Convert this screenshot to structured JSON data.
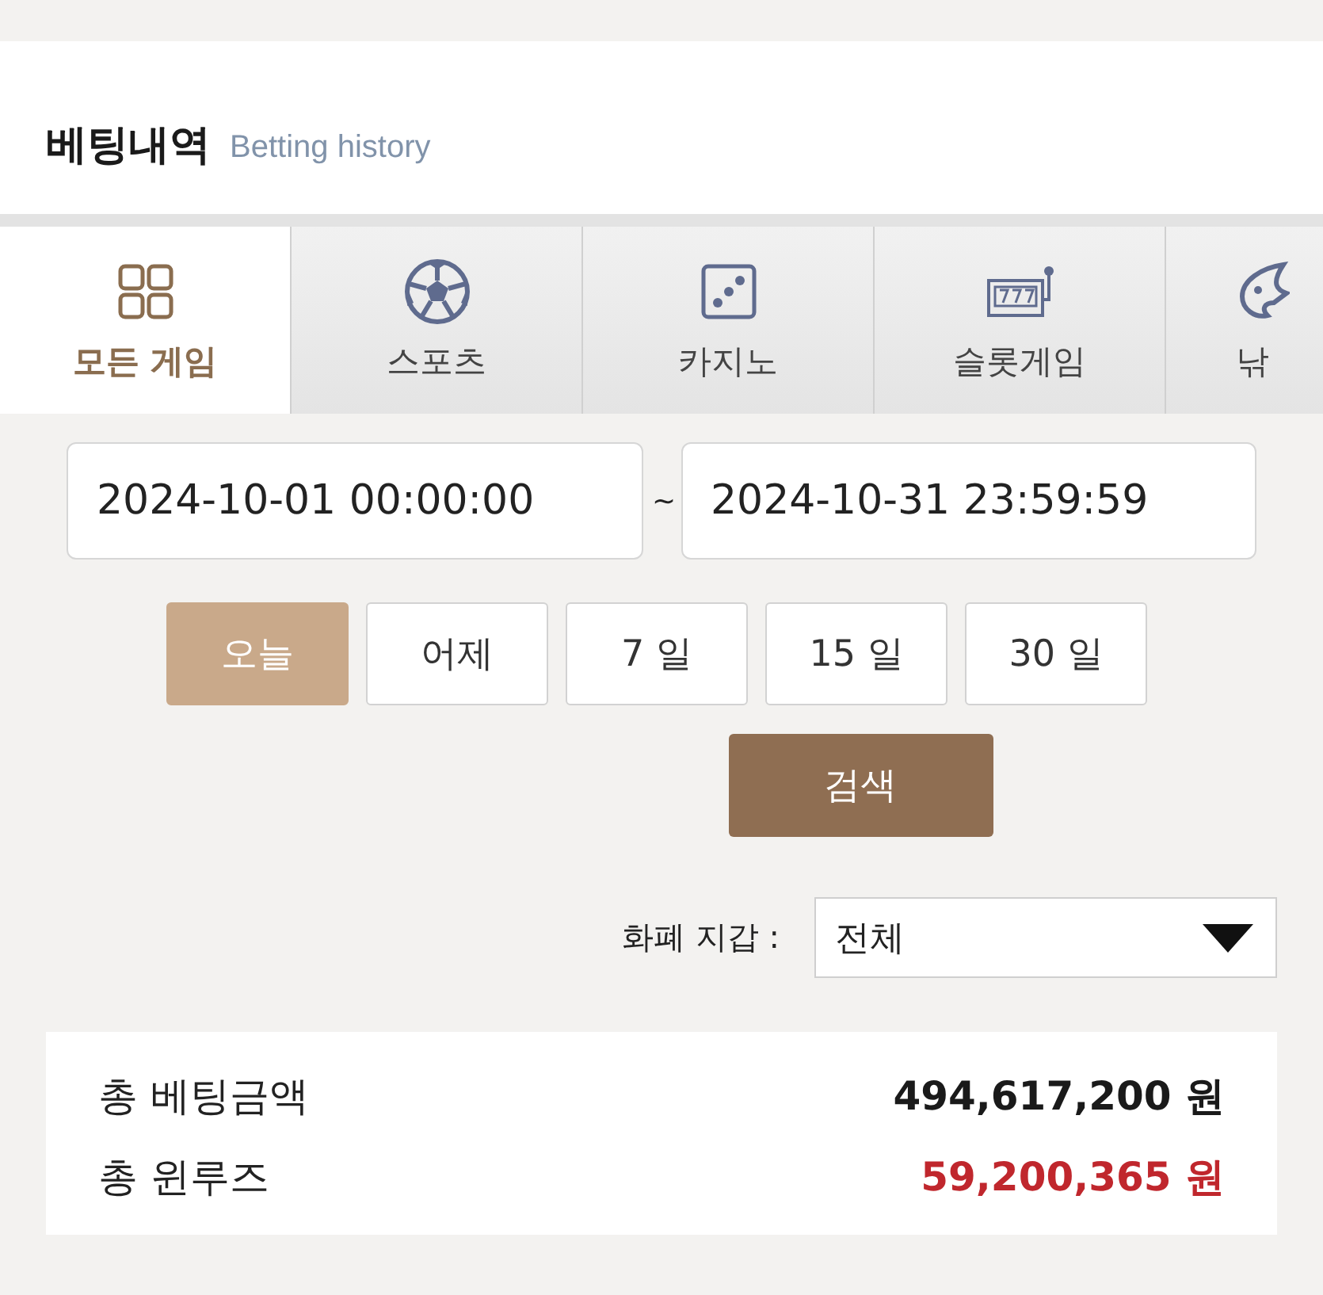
{
  "header": {
    "title": "베팅내역",
    "subtitle": "Betting history"
  },
  "tabs": [
    {
      "label": "모든 게임",
      "kind": "grid",
      "selected": true
    },
    {
      "label": "스포츠",
      "kind": "ball",
      "selected": false
    },
    {
      "label": "카지노",
      "kind": "dice",
      "selected": false
    },
    {
      "label": "슬롯게임",
      "kind": "slot",
      "selected": false
    },
    {
      "label": "낚",
      "kind": "fish",
      "selected": false
    }
  ],
  "date_range": {
    "start": "2024-10-01 00:00:00",
    "separator": "~",
    "end": "2024-10-31 23:59:59"
  },
  "quick_ranges": [
    {
      "label": "오늘",
      "selected": true
    },
    {
      "label": "어제",
      "selected": false
    },
    {
      "label": "7 일",
      "selected": false
    },
    {
      "label": "15 일",
      "selected": false
    },
    {
      "label": "30 일",
      "selected": false
    }
  ],
  "search_button": "검색",
  "currency_filter": {
    "label": "화폐 지갑 :",
    "value": "전체"
  },
  "summary": [
    {
      "label": "총 베팅금액",
      "value": "494,617,200 원",
      "color": "#1a1a1a"
    },
    {
      "label": "총 윈루즈",
      "value": "59,200,365 원",
      "color": "#c0272d"
    }
  ]
}
